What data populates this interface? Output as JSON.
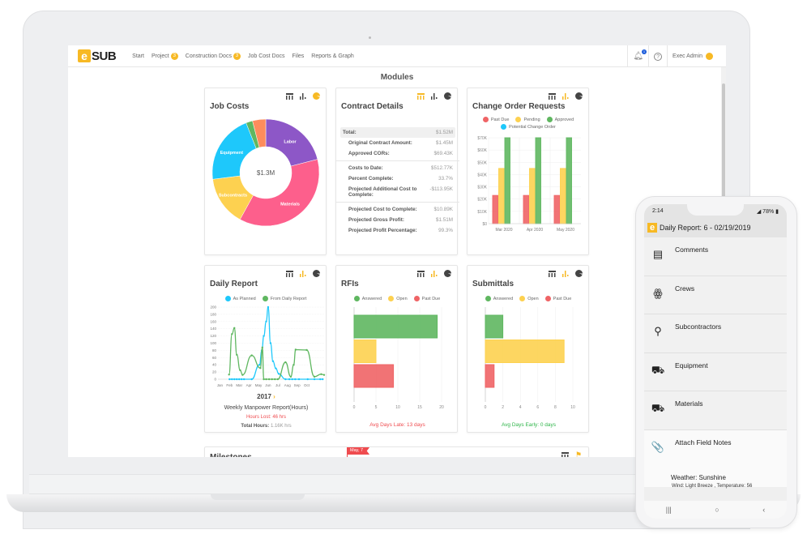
{
  "app": {
    "logo_e": "e",
    "logo_text": "SUB",
    "nav": [
      {
        "label": "Start"
      },
      {
        "label": "Project",
        "badge": "3"
      },
      {
        "label": "Construction Docs",
        "badge": "3"
      },
      {
        "label": "Job Cost Docs"
      },
      {
        "label": "Files"
      },
      {
        "label": "Reports & Graph"
      }
    ],
    "notifications_count": "1",
    "help_glyph": "?",
    "user_name": "Exec Admin",
    "page_title": "Modules"
  },
  "colors": {
    "accent": "#f7b924",
    "green": "#5fb760",
    "yellow": "#fdd150",
    "red": "#ef6466",
    "cyan": "#1ec8fb",
    "purple": "#8d57c7",
    "pink": "#fd5f8c",
    "orange": "#fd8c5c"
  },
  "cards": {
    "job_costs": {
      "title": "Job Costs",
      "center_label": "$1.3M"
    },
    "contract_details": {
      "title": "Contract Details",
      "total_label": "Total:",
      "total_value": "$1.52M",
      "groups": [
        [
          {
            "label": "Original Contract Amount:",
            "value": "$1.45M"
          },
          {
            "label": "Approved CORs:",
            "value": "$69.43K"
          }
        ],
        [
          {
            "label": "Costs to Date:",
            "value": "$512.77K"
          },
          {
            "label": "Percent Complete:",
            "value": "33.7%"
          },
          {
            "label": "Projected Additional Cost to Complete:",
            "value": "-$113.95K"
          }
        ],
        [
          {
            "label": "Projected Cost to Complete:",
            "value": "$10.89K"
          },
          {
            "label": "Projected Gross Profit:",
            "value": "$1.51M"
          },
          {
            "label": "Projected Profit Percentage:",
            "value": "99.3%"
          }
        ]
      ]
    },
    "change_orders": {
      "title": "Change Order Requests"
    },
    "daily_report": {
      "title": "Daily Report",
      "year_label": "2017",
      "next_glyph": "›",
      "subtitle": "Weekly Manpower Report(Hours)",
      "hours_lost_label": "Hours Lost:",
      "hours_lost_value": "46 hrs",
      "total_hours_label": "Total Hours:",
      "total_hours_value": "1.16K hrs"
    },
    "rfis": {
      "title": "RFIs",
      "footer": "Avg Days Late: 13 days"
    },
    "submittals": {
      "title": "Submittals",
      "footer": "Avg Days Early: 0 days"
    },
    "milestones": {
      "title": "Milestones",
      "flag_label": "May, 7"
    }
  },
  "chart_data": [
    {
      "id": "job_costs",
      "type": "pie",
      "title": "Job Costs",
      "center_label": "$1.3M",
      "slices": [
        {
          "label": "Labor",
          "value": 21,
          "color": "#8d57c7"
        },
        {
          "label": "Materials",
          "value": 37,
          "color": "#fd5f8c"
        },
        {
          "label": "Subcontracts",
          "value": 15,
          "color": "#fdd150"
        },
        {
          "label": "Equipment",
          "value": 21,
          "color": "#1ec8fb"
        },
        {
          "label": "",
          "value": 2,
          "color": "#5fb760"
        },
        {
          "label": "",
          "value": 4,
          "color": "#fd8c5c"
        }
      ]
    },
    {
      "id": "change_orders",
      "type": "bar",
      "title": "Change Order Requests",
      "categories": [
        "Mar 2020",
        "Apr 2020",
        "May 2020"
      ],
      "series": [
        {
          "name": "Past Due",
          "color": "#ef6466",
          "values": [
            23000,
            23000,
            23000
          ]
        },
        {
          "name": "Pending",
          "color": "#fdd150",
          "values": [
            45000,
            45000,
            45000
          ]
        },
        {
          "name": "Approved",
          "color": "#5fb760",
          "values": [
            70000,
            70000,
            70000
          ]
        },
        {
          "name": "Potential Change Order",
          "color": "#1ec8fb",
          "values": [
            0,
            0,
            0
          ]
        }
      ],
      "yticks": [
        "$0",
        "$10K",
        "$20K",
        "$30K",
        "$40K",
        "$50K",
        "$60K",
        "$70K"
      ],
      "ylim": [
        0,
        70000
      ],
      "grid": true,
      "legend": "top"
    },
    {
      "id": "daily_report",
      "type": "line",
      "title": "Daily Report",
      "xticks": [
        "Jan",
        "Feb",
        "Mar",
        "Apr",
        "May",
        "Jun",
        "Jul",
        "Aug",
        "Sep",
        "Oct"
      ],
      "yticks": [
        0,
        20,
        40,
        60,
        80,
        100,
        120,
        140,
        160,
        180,
        200
      ],
      "ylim": [
        0,
        200
      ],
      "xlim": [
        0,
        11
      ],
      "series": [
        {
          "name": "As Planned",
          "color": "#1ec8fb",
          "x": [
            1.2,
            1.45,
            1.7,
            1.95,
            2.2,
            2.45,
            2.7,
            3.5,
            4.3,
            4.55,
            4.75,
            5.0,
            5.2,
            5.45,
            5.7,
            6.0,
            6.3,
            7.0,
            7.4,
            7.7,
            8.0,
            8.4,
            9.3,
            10.0,
            10.6,
            10.85
          ],
          "y": [
            0,
            0,
            0,
            0,
            0,
            0,
            0,
            0,
            40,
            80,
            120,
            160,
            200,
            100,
            50,
            30,
            15,
            0,
            0,
            0,
            0,
            0,
            0,
            0,
            0,
            0
          ]
        },
        {
          "name": "From Daily Report",
          "color": "#5fb760",
          "x": [
            1.15,
            1.45,
            1.7,
            1.95,
            2.3,
            2.55,
            3.5,
            4.4,
            4.6,
            4.75,
            5.0,
            5.3,
            5.6,
            5.9,
            6.2,
            7.0,
            7.55,
            7.85,
            8.05,
            9.2,
            10.0,
            10.7,
            11.0
          ],
          "y": [
            13,
            125,
            142,
            68,
            25,
            12,
            66,
            31,
            88,
            0,
            0,
            0,
            0,
            0,
            0,
            47,
            7,
            40,
            82,
            81,
            7,
            14,
            12
          ]
        }
      ],
      "grid": true,
      "legend": "top"
    },
    {
      "id": "rfis",
      "type": "bar",
      "orientation": "horizontal",
      "title": "RFIs",
      "categories": [
        "Answered",
        "Open",
        "Past Due"
      ],
      "values": [
        19,
        5,
        9
      ],
      "colors": [
        "#5fb760",
        "#fdd150",
        "#ef6466"
      ],
      "xticks": [
        0,
        5,
        10,
        15,
        20
      ],
      "xlim": [
        0,
        20
      ],
      "grid": true,
      "legend": "top"
    },
    {
      "id": "submittals",
      "type": "bar",
      "orientation": "horizontal",
      "title": "Submittals",
      "categories": [
        "Answered",
        "Open",
        "Past Due"
      ],
      "values": [
        2,
        9,
        1
      ],
      "colors": [
        "#5fb760",
        "#fdd150",
        "#ef6466"
      ],
      "xticks": [
        0,
        2,
        4,
        6,
        8,
        10
      ],
      "xlim": [
        0,
        10
      ],
      "grid": true,
      "legend": "top"
    }
  ],
  "phone": {
    "time": "2:14",
    "battery": "78%",
    "header_title": "Daily Report: 6 - 02/19/2019",
    "items": [
      {
        "label": "Comments",
        "icon": "comment-icon",
        "glyph": "▤"
      },
      {
        "label": "Crews",
        "icon": "crew-icon",
        "glyph": "ꙮ"
      },
      {
        "label": "Subcontractors",
        "icon": "person-icon",
        "glyph": "⚲"
      },
      {
        "label": "Equipment",
        "icon": "truck-mixer-icon",
        "glyph": "⛟"
      },
      {
        "label": "Materials",
        "icon": "delivery-truck-icon",
        "glyph": "⛟"
      },
      {
        "label": "Attach Field Notes",
        "icon": "paperclip-icon",
        "glyph": "📎"
      }
    ],
    "weather": "Weather: Sunshine",
    "wind": "Wind: Light Breeze , Temperature: 56",
    "nav_recent": "|||",
    "nav_home": "○",
    "nav_back": "‹"
  }
}
